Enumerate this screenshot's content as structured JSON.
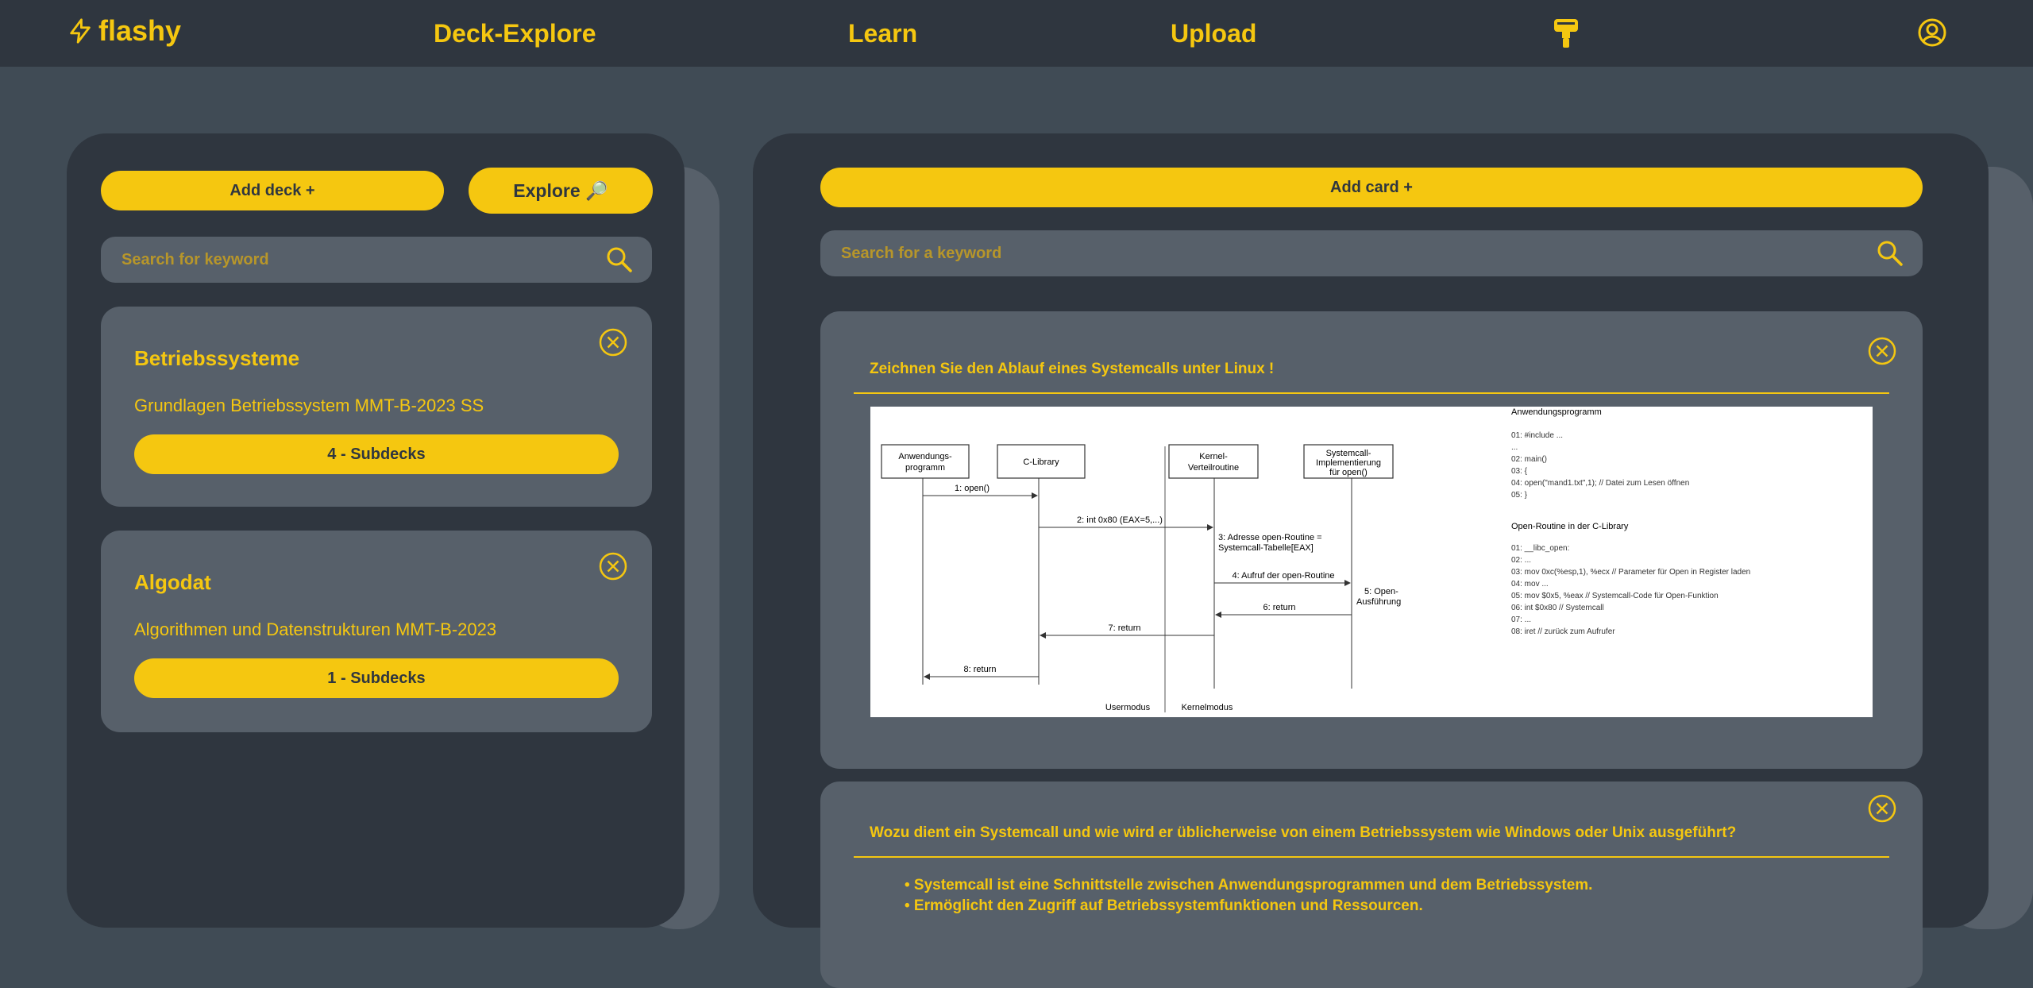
{
  "nav": {
    "logo_text": "flashy",
    "links": [
      "Deck-Explore",
      "Learn",
      "Upload"
    ]
  },
  "left": {
    "add_deck_label": "Add deck +",
    "explore_label": "Explore 🔎",
    "search_placeholder": "Search for keyword",
    "decks": [
      {
        "title": "Betriebssysteme",
        "description": "Grundlagen Betriebssystem MMT-B-2023 SS",
        "subdecks_label": "4 - Subdecks"
      },
      {
        "title": "Algodat",
        "description": "Algorithmen und Datenstrukturen MMT-B-2023",
        "subdecks_label": "1 - Subdecks"
      }
    ]
  },
  "right": {
    "add_card_label": "Add card +",
    "search_placeholder": "Search for a keyword",
    "cards": [
      {
        "question": "Zeichnen Sie den Ablauf eines Systemcalls unter Linux !"
      },
      {
        "question": "Wozu dient ein Systemcall und wie wird er üblicherweise von einem Betriebssystem wie Windows oder Unix ausgeführt?",
        "bullets": [
          "• Systemcall ist eine Schnittstelle zwischen Anwendungsprogrammen und dem Betriebssystem.",
          "• Ermöglicht den Zugriff auf Betriebssystemfunktionen und Ressourcen."
        ]
      }
    ]
  },
  "diagram": {
    "actors": [
      "Anwendungs-",
      "programm",
      "C-Library",
      "Kernel-",
      "Verteilroutine",
      "Systemcall-",
      "Implementierung",
      "für open()"
    ],
    "messages": [
      "1: open()",
      "2: int 0x80 (EAX=5,...)",
      "3: Adresse open-Routine =",
      "Systemcall-Tabelle[EAX]",
      "4: Aufruf der open-Routine",
      "5: Open-",
      "Ausführung",
      "6: return",
      "7: return",
      "8: return"
    ],
    "modes": [
      "Usermodus",
      "Kernelmodus"
    ],
    "code_title_1": "Anwendungsprogramm",
    "code_1": [
      "01: #include ...",
      "...",
      "02: main()",
      "03: {",
      "04:    open(\"mand1.txt\",1);    // Datei zum Lesen öffnen",
      "05: }"
    ],
    "code_title_2": "Open-Routine in der C-Library",
    "code_2": [
      "01: __libc_open:",
      "02: ...",
      "03: mov 0xc(%esp,1), %ecx    // Parameter für Open in Register laden",
      "04: mov ...",
      "05: mov $0x5, %eax           // Systemcall-Code für Open-Funktion",
      "06:  int $0x80               // Systemcall",
      "07:       ...",
      "08: iret                     // zurück zum Aufrufer"
    ]
  },
  "colors": {
    "accent": "#f5c710",
    "panel": "#2f363f",
    "card": "#57606a",
    "background": "#404b55"
  }
}
